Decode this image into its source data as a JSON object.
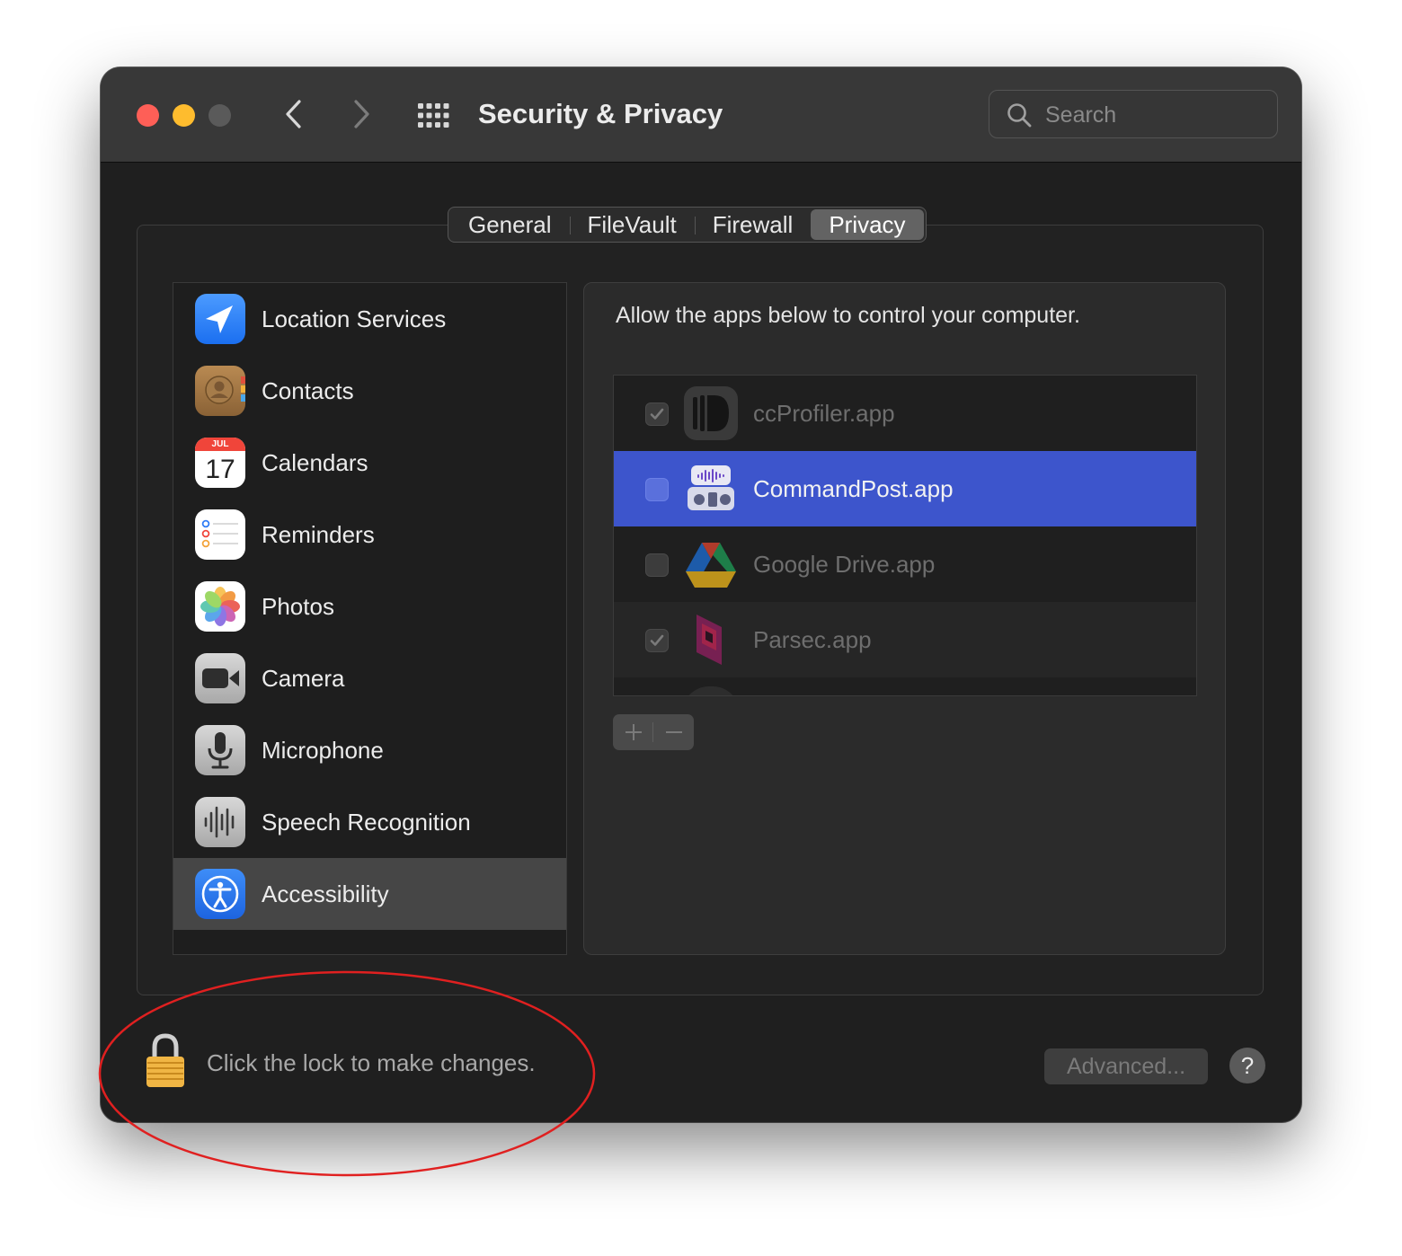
{
  "window": {
    "title": "Security & Privacy",
    "traffic_lights": {
      "close": "#fe5f57",
      "minimize": "#febc2e",
      "zoom": "#5a5a5a"
    },
    "nav": {
      "back_icon": "chevron-left-icon",
      "forward_icon": "chevron-right-icon",
      "grid_icon": "show-all-grid-icon"
    }
  },
  "search": {
    "placeholder": "Search",
    "value": ""
  },
  "tabs": [
    {
      "label": "General",
      "active": false
    },
    {
      "label": "FileVault",
      "active": false
    },
    {
      "label": "Firewall",
      "active": false
    },
    {
      "label": "Privacy",
      "active": true
    }
  ],
  "sidebar": {
    "items": [
      {
        "label": "Location Services",
        "icon": "location-arrow-icon",
        "selected": false
      },
      {
        "label": "Contacts",
        "icon": "contacts-book-icon",
        "selected": false
      },
      {
        "label": "Calendars",
        "icon": "calendar-icon",
        "month": "JUL",
        "day": "17",
        "selected": false
      },
      {
        "label": "Reminders",
        "icon": "reminders-list-icon",
        "selected": false
      },
      {
        "label": "Photos",
        "icon": "photos-flower-icon",
        "selected": false
      },
      {
        "label": "Camera",
        "icon": "video-camera-icon",
        "selected": false
      },
      {
        "label": "Microphone",
        "icon": "microphone-icon",
        "selected": false
      },
      {
        "label": "Speech Recognition",
        "icon": "waveform-icon",
        "selected": false
      },
      {
        "label": "Accessibility",
        "icon": "accessibility-person-icon",
        "selected": true
      }
    ]
  },
  "panel": {
    "instruction": "Allow the apps below to control your computer.",
    "apps": [
      {
        "name": "ccProfiler.app",
        "checked": true,
        "selected": false,
        "icon": "ccprofiler-app-icon"
      },
      {
        "name": "CommandPost.app",
        "checked": false,
        "selected": true,
        "icon": "commandpost-app-icon"
      },
      {
        "name": "Google Drive.app",
        "checked": false,
        "selected": false,
        "icon": "google-drive-app-icon"
      },
      {
        "name": "Parsec.app",
        "checked": true,
        "selected": false,
        "icon": "parsec-app-icon"
      }
    ],
    "add_label": "+",
    "remove_label": "−"
  },
  "footer": {
    "lock_text": "Click the lock to make changes.",
    "advanced_label": "Advanced...",
    "help_label": "?"
  },
  "colors": {
    "selection_blue": "#3d55cc",
    "annotation_red": "#e02020"
  }
}
